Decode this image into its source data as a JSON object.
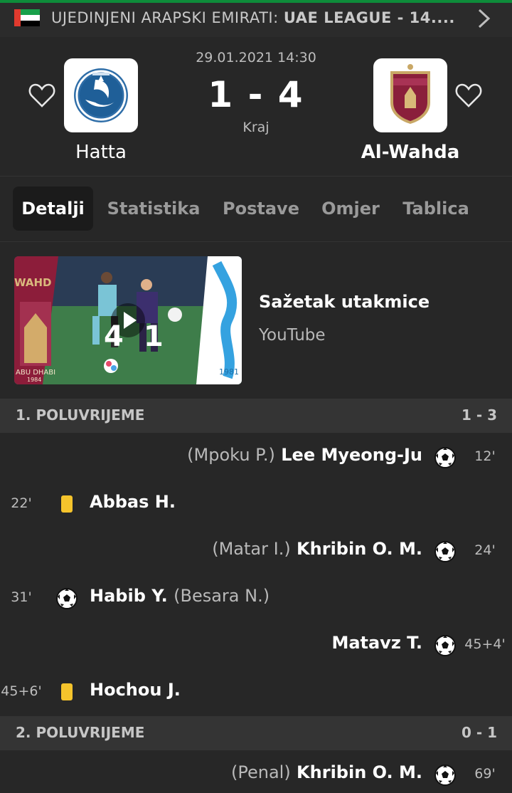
{
  "league": {
    "country": "UJEDINJENI ARAPSKI EMIRATI:",
    "name": "UAE LEAGUE - 14...."
  },
  "match": {
    "date": "29.01.2021 14:30",
    "score": "1 - 4",
    "status": "Kraj",
    "home": {
      "name": "Hatta"
    },
    "away": {
      "name": "Al-Wahda"
    }
  },
  "tabs": [
    {
      "label": "Detalji",
      "active": true
    },
    {
      "label": "Statistika"
    },
    {
      "label": "Postave"
    },
    {
      "label": "Omjer"
    },
    {
      "label": "Tablica"
    }
  ],
  "highlight": {
    "title": "Sažetak utakmice",
    "source": "YouTube",
    "thumb_left_text": "WAHD",
    "thumb_left_bottom": "ABU DHABI",
    "thumb_left_year": "1984",
    "thumb_right_year": "1981",
    "thumb_score_home": "4",
    "thumb_score_away": "1"
  },
  "periods": [
    {
      "label": "1. POLUVRIJEME",
      "score": "1 - 3"
    },
    {
      "label": "2. POLUVRIJEME",
      "score": "0 - 1"
    }
  ],
  "incidents": [
    {
      "side": "away",
      "type": "goal",
      "minute": "12'",
      "assist": "(Mpoku P.)",
      "player": "Lee Myeong-Ju"
    },
    {
      "side": "home",
      "type": "yellow-card",
      "minute": "22'",
      "player": "Abbas H."
    },
    {
      "side": "away",
      "type": "goal",
      "minute": "24'",
      "assist": "(Matar I.)",
      "player": "Khribin O. M."
    },
    {
      "side": "home",
      "type": "goal",
      "minute": "31'",
      "player": "Habib Y.",
      "assist": "(Besara N.)"
    },
    {
      "side": "away",
      "type": "goal",
      "minute": "45+4'",
      "player": "Matavz T."
    },
    {
      "side": "home",
      "type": "yellow-card",
      "minute": "45+6'",
      "player": "Hochou J."
    },
    {
      "side": "away",
      "type": "goal",
      "minute": "69'",
      "assist": "(Penal)",
      "player": "Khribin O. M."
    }
  ],
  "icons": {
    "goal": "soccer-ball-icon",
    "card": "yellow-card-icon",
    "favorite": "heart-outline-icon",
    "chevron": "chevron-right-icon"
  },
  "colors": {
    "accent_green": "#0e8c3a",
    "yellow_card": "#f5c42c",
    "background": "#272727"
  }
}
